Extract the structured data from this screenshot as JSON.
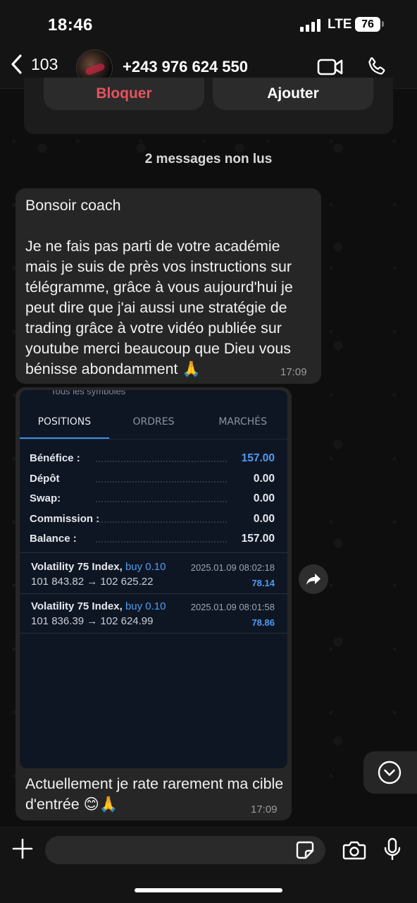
{
  "status_bar": {
    "time": "18:46",
    "network": "LTE",
    "battery": "76"
  },
  "header": {
    "back_count": "103",
    "contact": "+243 976 624 550"
  },
  "contact_actions": {
    "block_label": "Bloquer",
    "add_label": "Ajouter"
  },
  "unread_label": "2 messages non lus",
  "messages": [
    {
      "text": "Bonsoir coach\n\nJe ne fais pas parti de votre académie mais je suis de près vos instructions sur télégramme, grâce à vous aujourd'hui je peut dire que j'ai aussi une stratégie de trading grâce à votre vidéo publiée sur youtube merci beaucoup que Dieu vous bénisse abondamment 🙏",
      "time": "17:09"
    },
    {
      "text": "Actuellement je rate rarement ma cible d'entrée 😊🙏",
      "time": "17:09",
      "screenshot": {
        "cut_text": "Tous les symboles",
        "tabs": [
          "POSITIONS",
          "ORDRES",
          "MARCHÉS"
        ],
        "active_tab": "POSITIONS",
        "summary": [
          {
            "label": "Bénéfice :",
            "value": "157.00"
          },
          {
            "label": "Dépôt",
            "value": "0.00"
          },
          {
            "label": "Swap:",
            "value": "0.00"
          },
          {
            "label": "Commission :",
            "value": "0.00"
          },
          {
            "label": "Balance :",
            "value": "157.00"
          }
        ],
        "positions": [
          {
            "symbol": "Volatility 75 Index,",
            "side": "buy 0.10",
            "prices": "101 843.82 → 102 625.22",
            "date": "2025.01.09 08:02:18",
            "profit": "78.14"
          },
          {
            "symbol": "Volatility 75 Index,",
            "side": "buy 0.10",
            "prices": "101 836.39 → 102 624.99",
            "date": "2025.01.09 08:01:58",
            "profit": "78.86"
          }
        ]
      }
    }
  ],
  "composer": {
    "placeholder": ""
  },
  "colors": {
    "accent_blue": "#4e9cf2",
    "block_red": "#e5535f",
    "bubble": "#262626"
  }
}
